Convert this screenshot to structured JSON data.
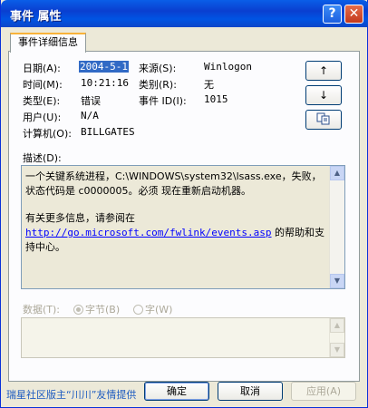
{
  "window": {
    "title": "事件 属性",
    "help": "?",
    "close": "✕"
  },
  "tab": {
    "label": "事件详细信息"
  },
  "fields": {
    "date_label": "日期(A):",
    "date_value": "2004-5-1",
    "source_label": "来源(S):",
    "source_value": "Winlogon",
    "time_label": "时间(M):",
    "time_value": "10:21:16",
    "category_label": "类别(R):",
    "category_value": "无",
    "type_label": "类型(E):",
    "type_value": "错误",
    "eventid_label": "事件 ID(I):",
    "eventid_value": "1015",
    "user_label": "用户(U):",
    "user_value": "N/A",
    "computer_label": "计算机(O):",
    "computer_value": "BILLGATES"
  },
  "side_buttons": {
    "up": "↑",
    "down": "↓",
    "copy": "copy-icon"
  },
  "description": {
    "label": "描述(D):",
    "text1": "一个关键系统进程，C:\\WINDOWS\\system32\\lsass.exe，失败，状态代码是 c0000005。必须 现在重新启动机器。",
    "text2": "有关更多信息，请参阅在",
    "link": "http://go.microsoft.com/fwlink/events.asp",
    "text3": "的帮助和支持中心。"
  },
  "data_section": {
    "label": "数据(T):",
    "bytes": "字节(B)",
    "words": "字(W)"
  },
  "footer": {
    "credit": "瑞星社区版主“川川”友情提供"
  },
  "buttons": {
    "ok": "确定",
    "cancel": "取消",
    "apply": "应用(A)"
  }
}
